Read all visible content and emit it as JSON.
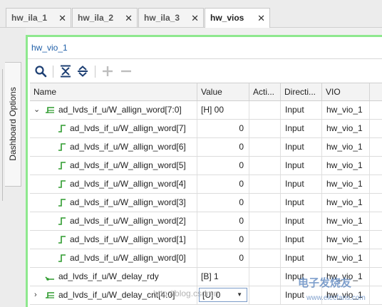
{
  "tabs": [
    {
      "label": "hw_ila_1",
      "active": false
    },
    {
      "label": "hw_ila_2",
      "active": false
    },
    {
      "label": "hw_ila_3",
      "active": false
    },
    {
      "label": "hw_vios",
      "active": true
    }
  ],
  "close_glyph": "✕",
  "side_tab": {
    "label": "Dashboard Options"
  },
  "panel": {
    "title": "hw_vio_1"
  },
  "toolbar": {
    "icons": [
      "search-icon",
      "collapse-all-icon",
      "expand-all-icon",
      "add-icon",
      "remove-icon"
    ]
  },
  "columns": {
    "name": "Name",
    "value": "Value",
    "activity": "Acti...",
    "direction": "Directi...",
    "vio": "VIO"
  },
  "rows": [
    {
      "name": "ad_lvds_if_u/W_allign_word[7:0]",
      "value": "[H] 00",
      "direction": "Input",
      "vio": "hw_vio_1",
      "type": "bus",
      "expander": "expanded"
    },
    {
      "name": "ad_lvds_if_u/W_allign_word[7]",
      "value": "0",
      "direction": "Input",
      "vio": "hw_vio_1",
      "type": "bit"
    },
    {
      "name": "ad_lvds_if_u/W_allign_word[6]",
      "value": "0",
      "direction": "Input",
      "vio": "hw_vio_1",
      "type": "bit"
    },
    {
      "name": "ad_lvds_if_u/W_allign_word[5]",
      "value": "0",
      "direction": "Input",
      "vio": "hw_vio_1",
      "type": "bit"
    },
    {
      "name": "ad_lvds_if_u/W_allign_word[4]",
      "value": "0",
      "direction": "Input",
      "vio": "hw_vio_1",
      "type": "bit"
    },
    {
      "name": "ad_lvds_if_u/W_allign_word[3]",
      "value": "0",
      "direction": "Input",
      "vio": "hw_vio_1",
      "type": "bit"
    },
    {
      "name": "ad_lvds_if_u/W_allign_word[2]",
      "value": "0",
      "direction": "Input",
      "vio": "hw_vio_1",
      "type": "bit"
    },
    {
      "name": "ad_lvds_if_u/W_allign_word[1]",
      "value": "0",
      "direction": "Input",
      "vio": "hw_vio_1",
      "type": "bit"
    },
    {
      "name": "ad_lvds_if_u/W_allign_word[0]",
      "value": "0",
      "direction": "Input",
      "vio": "hw_vio_1",
      "type": "bit"
    },
    {
      "name": "ad_lvds_if_u/W_delay_rdy",
      "value": "[B] 1",
      "direction": "Input",
      "vio": "hw_vio_1",
      "type": "signal"
    },
    {
      "name": "ad_lvds_if_u/W_delay_cnt[4:0]",
      "value": "[U] 0",
      "direction": "Input",
      "vio": "hw_vio_1",
      "type": "bus",
      "expander": "collapsed",
      "editable": true
    }
  ],
  "watermark": {
    "text": "http://blog.csdn.n",
    "brand": "电子发烧友",
    "url": "www.elecfans.com"
  },
  "colors": {
    "accent_green": "#8ee88e",
    "link_blue": "#1f5fa8",
    "signal_green": "#2e9b2e"
  }
}
